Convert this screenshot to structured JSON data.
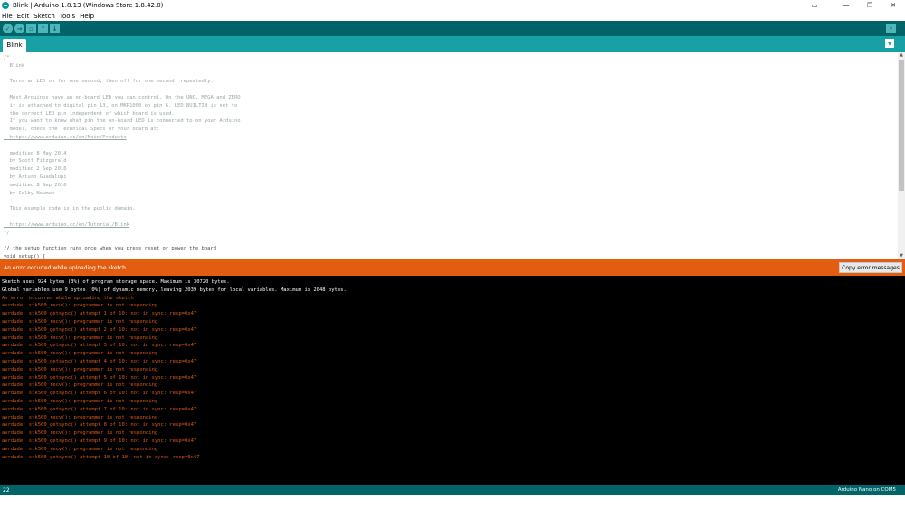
{
  "window": {
    "title": "Blink | Arduino 1.8.13 (Windows Store 1.8.42.0)"
  },
  "menu": [
    "File",
    "Edit",
    "Sketch",
    "Tools",
    "Help"
  ],
  "toolbar": {
    "verify_glyph": "✓",
    "upload_glyph": "→",
    "new_glyph": "▫",
    "open_glyph": "↑",
    "save_glyph": "↓",
    "serial_glyph": "⌕"
  },
  "tabs": [
    {
      "label": "Blink"
    }
  ],
  "editor": {
    "lines": [
      {
        "text": "/*",
        "style": "comment"
      },
      {
        "text": "  Blink",
        "style": "comment"
      },
      {
        "text": "",
        "style": "comment"
      },
      {
        "text": "  Turns an LED on for one second, then off for one second, repeatedly.",
        "style": "comment"
      },
      {
        "text": "",
        "style": "comment"
      },
      {
        "text": "  Most Arduinos have an on-board LED you can control. On the UNO, MEGA and ZERO",
        "style": "comment"
      },
      {
        "text": "  it is attached to digital pin 13, on MKR1000 on pin 6. LED_BUILTIN is set to",
        "style": "comment"
      },
      {
        "text": "  the correct LED pin independent of which board is used.",
        "style": "comment"
      },
      {
        "text": "  If you want to know what pin the on-board LED is connected to on your Arduino",
        "style": "comment"
      },
      {
        "text": "  model, check the Technical Specs of your board at:",
        "style": "comment"
      },
      {
        "text": "  https://www.arduino.cc/en/Main/Products",
        "style": "link"
      },
      {
        "text": "",
        "style": "comment"
      },
      {
        "text": "  modified 8 May 2014",
        "style": "comment"
      },
      {
        "text": "  by Scott Fitzgerald",
        "style": "comment"
      },
      {
        "text": "  modified 2 Sep 2016",
        "style": "comment"
      },
      {
        "text": "  by Arturo Guadalupi",
        "style": "comment"
      },
      {
        "text": "  modified 8 Sep 2016",
        "style": "comment"
      },
      {
        "text": "  by Colby Newman",
        "style": "comment"
      },
      {
        "text": "",
        "style": "comment"
      },
      {
        "text": "  This example code is in the public domain.",
        "style": "comment"
      },
      {
        "text": "",
        "style": "comment"
      },
      {
        "text": "  https://www.arduino.cc/en/Tutorial/Blink",
        "style": "link"
      },
      {
        "text": "*/",
        "style": "comment"
      },
      {
        "text": "",
        "style": "comment"
      },
      {
        "text": "// the setup function runs once when you press reset or power the board",
        "style": "dark"
      },
      {
        "text": "void setup() {",
        "style": "dark"
      }
    ]
  },
  "error_bar": {
    "message": "An error occurred while uploading the sketch",
    "copy_button": "Copy error messages"
  },
  "console": {
    "lines": [
      {
        "text": "Sketch uses 924 bytes (3%) of program storage space. Maximum is 30720 bytes.",
        "color": "white"
      },
      {
        "text": "Global variables use 9 bytes (0%) of dynamic memory, leaving 2039 bytes for local variables. Maximum is 2048 bytes.",
        "color": "white"
      },
      {
        "text": "An error occurred while uploading the sketch",
        "color": "orange"
      },
      {
        "text": "avrdude: stk500_recv(): programmer is not responding",
        "color": "orange"
      },
      {
        "text": "avrdude: stk500_getsync() attempt 1 of 10: not in sync: resp=0x47",
        "color": "orange"
      },
      {
        "text": "avrdude: stk500_recv(): programmer is not responding",
        "color": "orange"
      },
      {
        "text": "avrdude: stk500_getsync() attempt 2 of 10: not in sync: resp=0x47",
        "color": "orange"
      },
      {
        "text": "avrdude: stk500_recv(): programmer is not responding",
        "color": "orange"
      },
      {
        "text": "avrdude: stk500_getsync() attempt 3 of 10: not in sync: resp=0x47",
        "color": "orange"
      },
      {
        "text": "avrdude: stk500_recv(): programmer is not responding",
        "color": "orange"
      },
      {
        "text": "avrdude: stk500_getsync() attempt 4 of 10: not in sync: resp=0x47",
        "color": "orange"
      },
      {
        "text": "avrdude: stk500_recv(): programmer is not responding",
        "color": "orange"
      },
      {
        "text": "avrdude: stk500_getsync() attempt 5 of 10: not in sync: resp=0x47",
        "color": "orange"
      },
      {
        "text": "avrdude: stk500_recv(): programmer is not responding",
        "color": "orange"
      },
      {
        "text": "avrdude: stk500_getsync() attempt 6 of 10: not in sync: resp=0x47",
        "color": "orange"
      },
      {
        "text": "avrdude: stk500_recv(): programmer is not responding",
        "color": "orange"
      },
      {
        "text": "avrdude: stk500_getsync() attempt 7 of 10: not in sync: resp=0x47",
        "color": "orange"
      },
      {
        "text": "avrdude: stk500_recv(): programmer is not responding",
        "color": "orange"
      },
      {
        "text": "avrdude: stk500_getsync() attempt 8 of 10: not in sync: resp=0x47",
        "color": "orange"
      },
      {
        "text": "avrdude: stk500_recv(): programmer is not responding",
        "color": "orange"
      },
      {
        "text": "avrdude: stk500_getsync() attempt 9 of 10: not in sync: resp=0x47",
        "color": "orange"
      },
      {
        "text": "avrdude: stk500_recv(): programmer is not responding",
        "color": "orange"
      },
      {
        "text": "avrdude: stk500_getsync() attempt 10 of 10: not in sync: resp=0x47",
        "color": "orange"
      }
    ]
  },
  "status": {
    "line_number": "22",
    "board": "Arduino Nano on COM5"
  },
  "colors": {
    "toolbar": "#006468",
    "tabbar": "#17a1a5",
    "error_bar": "#e35d11",
    "console_bg": "#000000",
    "console_error": "#d85a1a"
  },
  "icons": {
    "app": "arduino-infinity-icon",
    "verify": "check-icon",
    "upload": "arrow-right-icon",
    "new": "new-file-icon",
    "open": "open-arrow-up-icon",
    "save": "save-arrow-down-icon",
    "serial": "serial-monitor-magnifier-icon",
    "tab_menu": "chevron-down-icon"
  }
}
